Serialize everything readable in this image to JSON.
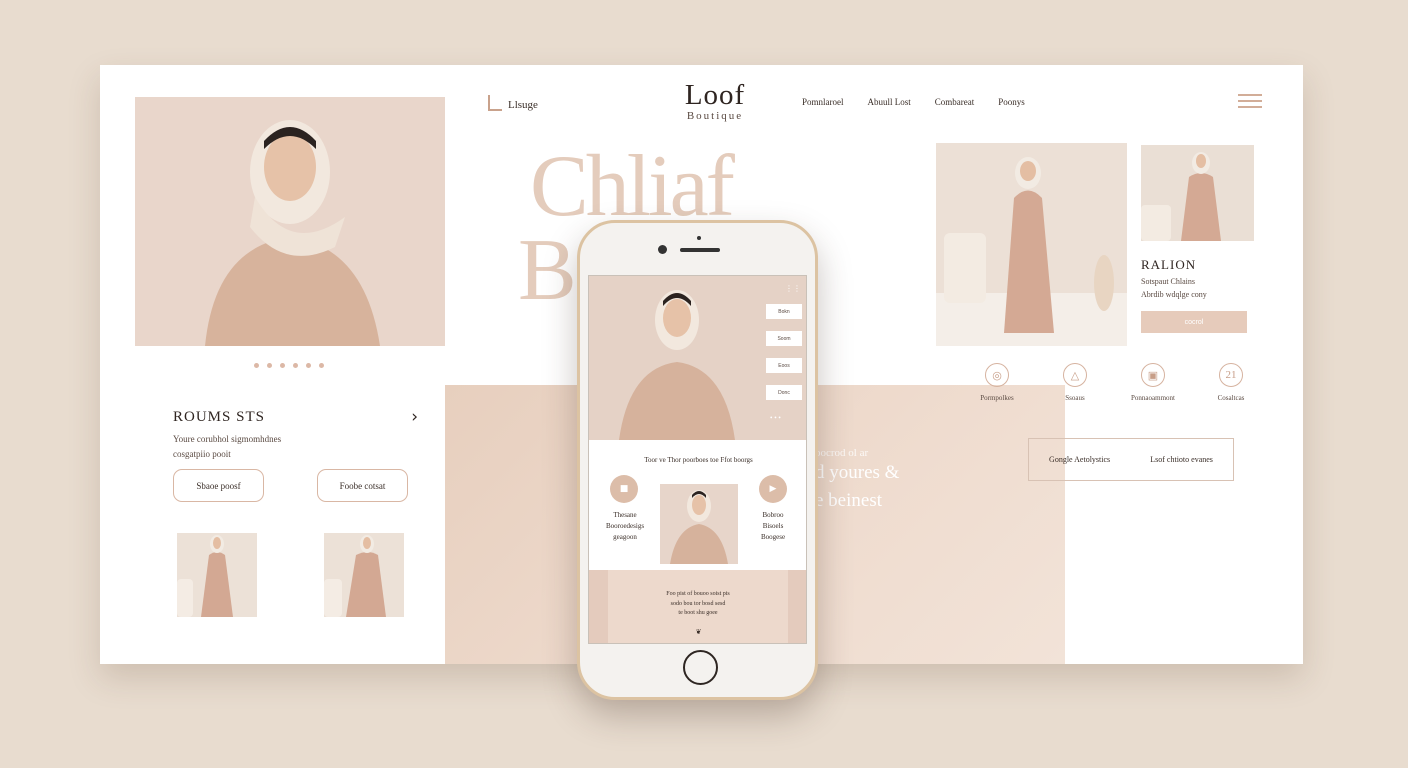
{
  "header": {
    "logo_mark_text": "Llsuge",
    "brand_name": "Loof",
    "brand_sub": "Boutique",
    "nav": [
      "Pomnlaroel",
      "Abuull Lost",
      "Combareat",
      "Poonys"
    ]
  },
  "hero": {
    "title_line1": "Chliaf",
    "title_line2": "Bo    e",
    "dots_count": 6
  },
  "rooms": {
    "title": "ROUMS STS",
    "arrow": "›",
    "desc_line1": "Youre corubhol sigmomhdnes",
    "desc_line2": "cosgatpiio pooit",
    "button_left": "Sbaoe poosf",
    "button_right": "Foobe cotsat"
  },
  "side": {
    "title": "RALION",
    "line1": "Sotspaut Chlains",
    "line2": "Abrdib wdqlge cony",
    "button": "cocrol"
  },
  "features": [
    {
      "icon": "◎",
      "label": "Pormpolkes",
      "icon_name": "target-icon"
    },
    {
      "icon": "△",
      "label": "Ssoaus",
      "icon_name": "triangle-icon"
    },
    {
      "icon": "▣",
      "label": "Ponnaoammont",
      "icon_name": "frame-icon"
    },
    {
      "icon": "21",
      "label": "Cosaltcas",
      "icon_name": "number-icon"
    }
  ],
  "band_text": {
    "small": "oocrod ol ar",
    "line1": "d youres &",
    "line2": "e beinest"
  },
  "info_box": {
    "left": "Gongle Aetolystics",
    "right": "Lsof chtioto evanes"
  },
  "phone": {
    "menu": "⋮⋮",
    "side_buttons": [
      "Bokn",
      "Soom",
      "Eoos",
      "Donc"
    ],
    "more": "• • •",
    "caption": "Toor ve Thor poorboes toe Ffot boorgs",
    "left_text": [
      "Thesane",
      "Booroedesigs",
      "geagoon"
    ],
    "right_text": [
      "Bobroo",
      "Bisoels",
      "Boogese"
    ],
    "bottom_lines": [
      "Foo pist of bouoo soist pis",
      "sodo bou tor bosd sesd",
      "te boot shu goee"
    ],
    "bottom_mark": "❦"
  },
  "colors": {
    "background": "#e8dccf",
    "accent": "#dcbda9",
    "text_dark": "#2f2521"
  }
}
